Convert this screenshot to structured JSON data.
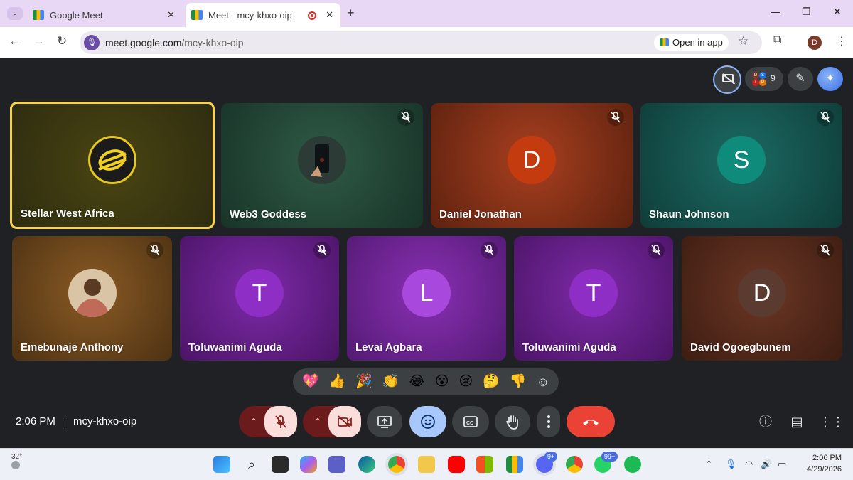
{
  "browser": {
    "tabs": [
      {
        "title": "Google Meet",
        "active": false
      },
      {
        "title": "Meet - mcy-khxo-oip",
        "active": true
      }
    ],
    "url_host": "meet.google.com",
    "url_path": "/mcy-khxo-oip",
    "open_in_app_label": "Open in app",
    "profile_initial": "D"
  },
  "meet": {
    "participants_count": "9",
    "tiles": [
      {
        "name": "Stellar West Africa",
        "muted": false,
        "speaking": true
      },
      {
        "name": "Web3 Goddess",
        "muted": true
      },
      {
        "name": "Daniel Jonathan",
        "initial": "D",
        "muted": true
      },
      {
        "name": "Shaun Johnson",
        "initial": "S",
        "muted": true
      },
      {
        "name": "Emebunaje Anthony",
        "muted": true
      },
      {
        "name": "Toluwanimi Aguda",
        "initial": "T",
        "muted": true
      },
      {
        "name": "Levai Agbara",
        "initial": "L",
        "muted": true
      },
      {
        "name": "Toluwanimi Aguda",
        "initial": "T",
        "muted": true
      },
      {
        "name": "David Ogoegbunem",
        "initial": "D",
        "muted": true
      }
    ],
    "reactions": [
      "💖",
      "👍",
      "🎉",
      "👏",
      "😂",
      "😮",
      "😢",
      "🤔",
      "👎"
    ],
    "time": "2:06 PM",
    "meeting_code": "mcy-khxo-oip"
  },
  "taskbar": {
    "temperature": "32°",
    "discord_badge": "9+",
    "whatsapp_badge": "99+",
    "clock_time": "2:06 PM",
    "clock_date": "4/29/2026"
  }
}
